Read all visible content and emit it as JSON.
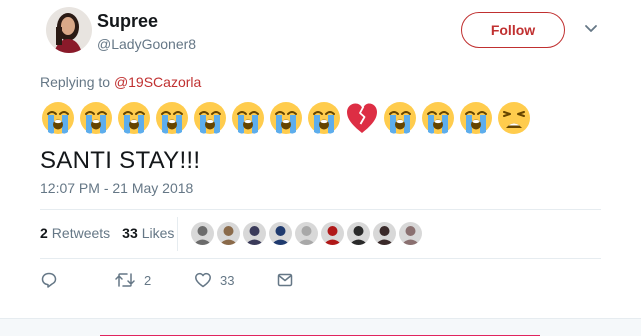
{
  "author": {
    "display_name": "Supree",
    "handle": "@LadyGooner8",
    "avatar_icon": "profile-photo"
  },
  "follow_label": "Follow",
  "menu_icon": "chevron-down-icon",
  "reply": {
    "prefix": "Replying to",
    "mention": "@19SCazorla"
  },
  "emojis": [
    "loudly-crying-face",
    "loudly-crying-face",
    "loudly-crying-face",
    "loudly-crying-face",
    "loudly-crying-face",
    "loudly-crying-face",
    "loudly-crying-face",
    "loudly-crying-face",
    "broken-heart",
    "loudly-crying-face",
    "loudly-crying-face",
    "loudly-crying-face",
    "weary-face"
  ],
  "tweet_text": "SANTI STAY!!!",
  "timestamp": "12:07 PM - 21 May 2018",
  "stats": {
    "retweets_count": "2",
    "retweets_label": "Retweets",
    "likes_count": "33",
    "likes_label": "Likes"
  },
  "likers": [
    "#6b6b6b",
    "#8a6a4a",
    "#3b3b5a",
    "#1f3a6e",
    "#a8a8a8",
    "#b01818",
    "#2a2a2a",
    "#3a2a2a",
    "#8a7070"
  ],
  "actions": {
    "reply_count": "",
    "retweet_count": "2",
    "like_count": "33"
  },
  "colors": {
    "accent": "#c03030",
    "muted": "#657786",
    "text": "#14171a"
  }
}
